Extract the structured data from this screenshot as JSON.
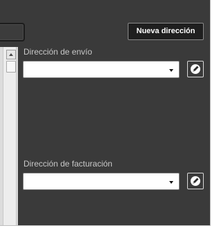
{
  "toolbar": {
    "new_address_label": "Nueva dirección"
  },
  "shipping": {
    "label": "Dirección de envío",
    "selected_value": ""
  },
  "billing": {
    "label": "Dirección de facturación",
    "selected_value": ""
  },
  "icons": {
    "dropdown": "chevron-down-icon",
    "edit": "pencil-icon"
  },
  "colors": {
    "panel_background": "#3a3a3a",
    "button_background": "#1f1f1f",
    "label_text": "#c8c8c8"
  }
}
